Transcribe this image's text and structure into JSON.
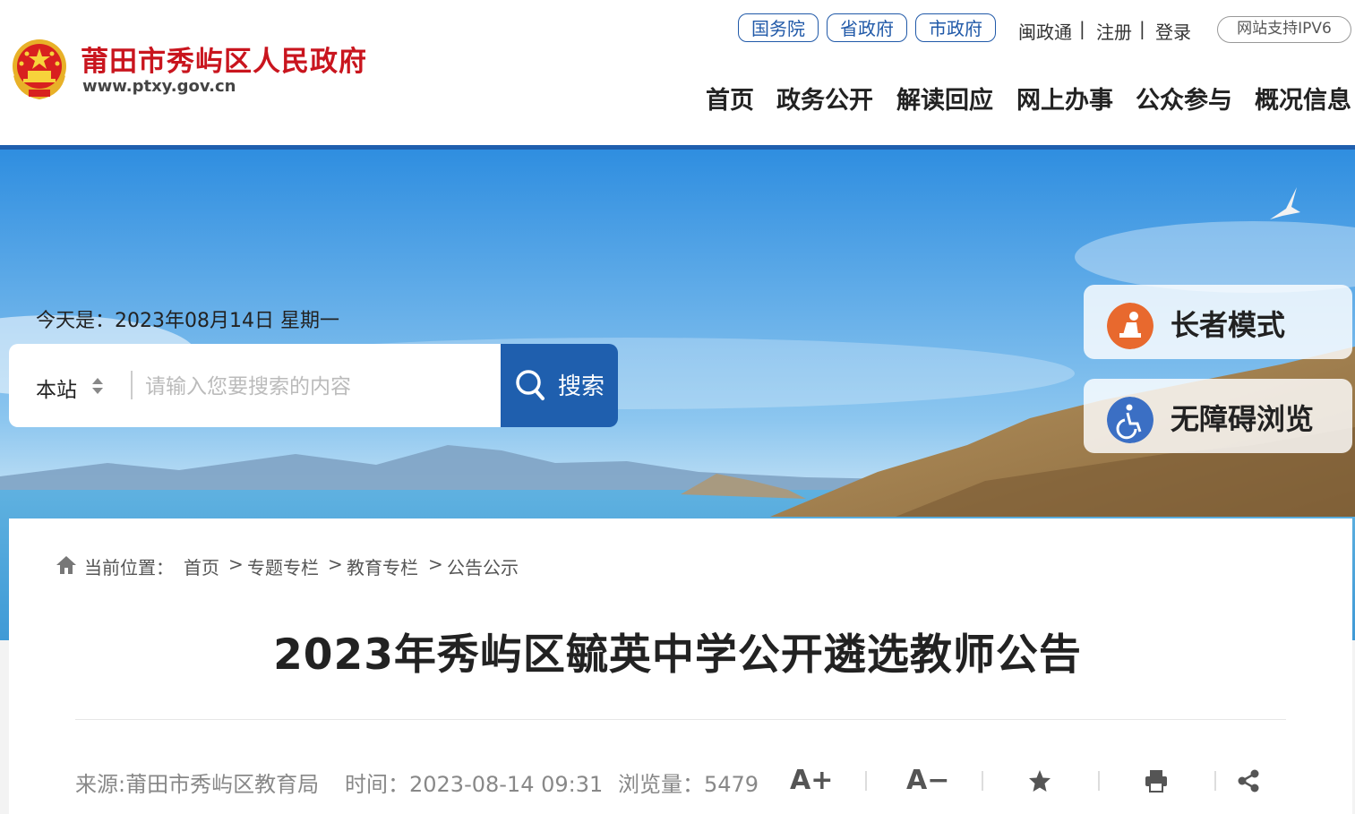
{
  "header": {
    "site_name": "莆田市秀屿区人民政府",
    "site_url": "www.ptxy.gov.cn",
    "gov_links": [
      "国务院",
      "省政府",
      "市政府"
    ],
    "top_links": [
      "闽政通",
      "注册",
      "登录"
    ],
    "separator": "|",
    "ipv6_label": "网站支持IPV6",
    "nav": [
      "首页",
      "政务公开",
      "解读回应",
      "网上办事",
      "公众参与",
      "概况信息"
    ],
    "colors": {
      "brand_red": "#c9151e",
      "brand_blue": "#1f5fae"
    }
  },
  "banner": {
    "date_text": "今天是：2023年08月14日 星期一",
    "search_scope": "本站",
    "search_placeholder": "请输入您要搜索的内容",
    "search_button": "搜索",
    "elder_mode": "长者模式",
    "accessibility": "无障碍浏览",
    "elder_icon": "elder-person-icon",
    "accessibility_icon": "wheelchair-icon"
  },
  "breadcrumb": {
    "label": "当前位置：",
    "items": [
      "首页",
      "专题专栏",
      "教育专栏",
      "公告公示"
    ],
    "separator": ">"
  },
  "article": {
    "title": "2023年秀屿区毓英中学公开遴选教师公告",
    "source": "来源:莆田市秀屿区教育局",
    "time": "时间：2023-08-14 09:31",
    "views": "浏览量：5479"
  },
  "tools": {
    "font_bigger": "A+",
    "font_smaller": "A−",
    "icons": [
      "font-increase-icon",
      "font-decrease-icon",
      "star-icon",
      "print-icon",
      "share-icon"
    ]
  }
}
